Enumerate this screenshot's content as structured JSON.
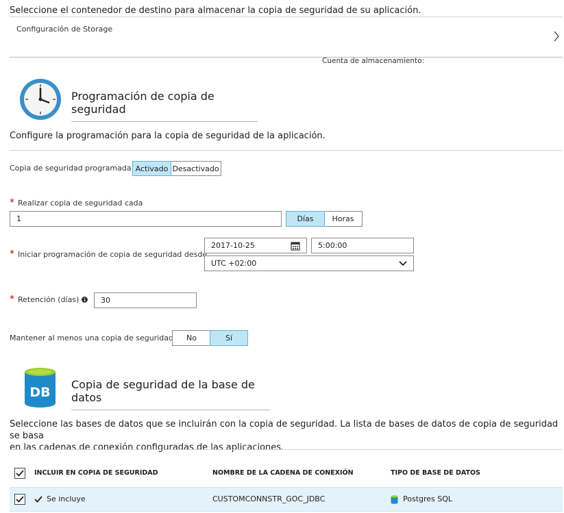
{
  "intro": "Seleccione el contenedor de destino para almacenar la copia de seguridad de su aplicación.",
  "storage": {
    "label": "Configuración de Storage",
    "account_label": "Cuenta de almacenamiento:"
  },
  "schedule": {
    "title": "Programación de copia de seguridad",
    "description": "Configure la programación para la copia de seguridad de la aplicación.",
    "scheduled_label": "Copia de seguridad programada",
    "scheduled_on": "Activado",
    "scheduled_off": "Desactivado",
    "every_label": "Realizar copia de seguridad cada",
    "every_value": "1",
    "unit_days": "Días",
    "unit_hours": "Horas",
    "start_label": "Iniciar programación de copia de seguridad desde",
    "start_date": "2017-10-25",
    "start_time": "5:00:00",
    "timezone": "UTC +02:00",
    "retention_label": "Retención (días)",
    "retention_value": "30",
    "keep_label": "Mantener al menos una copia de seguridad",
    "keep_no": "No",
    "keep_yes": "Sí"
  },
  "database": {
    "title": "Copia de seguridad de la base de datos",
    "icon_text": "DB",
    "description_line1": "Seleccione las bases de datos que se incluirán con la copia de seguridad. La lista de bases de datos de copia de seguridad se basa",
    "description_line2": "en las cadenas de conexión configuradas de las aplicaciones.",
    "columns": [
      "INCLUIR EN COPIA DE SEGURIDAD",
      "NOMBRE DE LA CADENA DE CONEXIÓN",
      "TIPO DE BASE DE DATOS"
    ],
    "rows": [
      {
        "include": "Se incluye",
        "connection": "CUSTOMCONNSTR_GOC_JDBC",
        "type": "Postgres SQL"
      }
    ]
  },
  "colors": {
    "accent": "#bfe6f7",
    "accent_border": "#5fb3d6",
    "db_icon": "#1f8ac9",
    "db_icon_top": "#9ccc2b"
  }
}
